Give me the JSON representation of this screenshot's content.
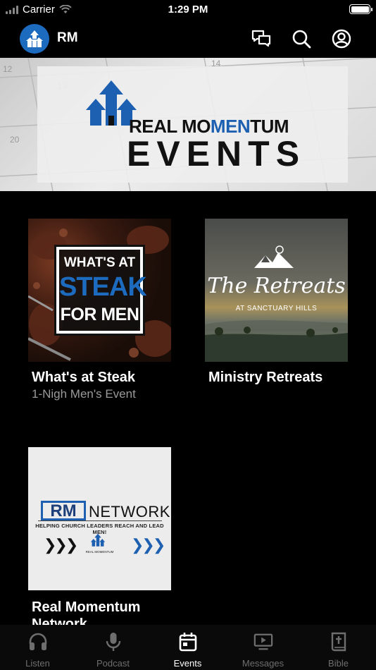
{
  "status_bar": {
    "carrier": "Carrier",
    "time": "1:29 PM",
    "battery_level": 1.0
  },
  "header": {
    "title": "RM",
    "icons": [
      "chat-bubbles-icon",
      "search-icon",
      "account-icon"
    ]
  },
  "hero": {
    "line1_part1": "REAL MO",
    "line1_accent": "MEN",
    "line1_part2": "TUM",
    "line2": "EVENTS",
    "calendar_dates": [
      "12",
      "13",
      "14",
      "20"
    ]
  },
  "events": [
    {
      "title": "What's at Steak",
      "subtitle": "1-Nigh Men's Event",
      "image_text": [
        "WHAT'S AT",
        "STEAK",
        "FOR MEN"
      ]
    },
    {
      "title": "Ministry Retreats",
      "subtitle": "",
      "image_text": [
        "The Retreats",
        "AT SANCTUARY HILLS"
      ]
    },
    {
      "title": "Real Momentum Network",
      "subtitle": "",
      "image_text": [
        "RM",
        "NETWORK",
        "HELPING CHURCH LEADERS REACH AND LEAD MEN!",
        "REAL MOMENTUM"
      ]
    }
  ],
  "tabs": [
    {
      "label": "Listen",
      "icon": "headphones-icon",
      "active": false
    },
    {
      "label": "Podcast",
      "icon": "microphone-icon",
      "active": false
    },
    {
      "label": "Events",
      "icon": "calendar-icon",
      "active": true
    },
    {
      "label": "Messages",
      "icon": "video-player-icon",
      "active": false
    },
    {
      "label": "Bible",
      "icon": "bible-icon",
      "active": false
    }
  ],
  "colors": {
    "background": "#000000",
    "brand_blue": "#1d5fb0",
    "tab_inactive": "#6e6e6e",
    "tab_active": "#ffffff",
    "subtitle_gray": "#9a9a9a"
  }
}
